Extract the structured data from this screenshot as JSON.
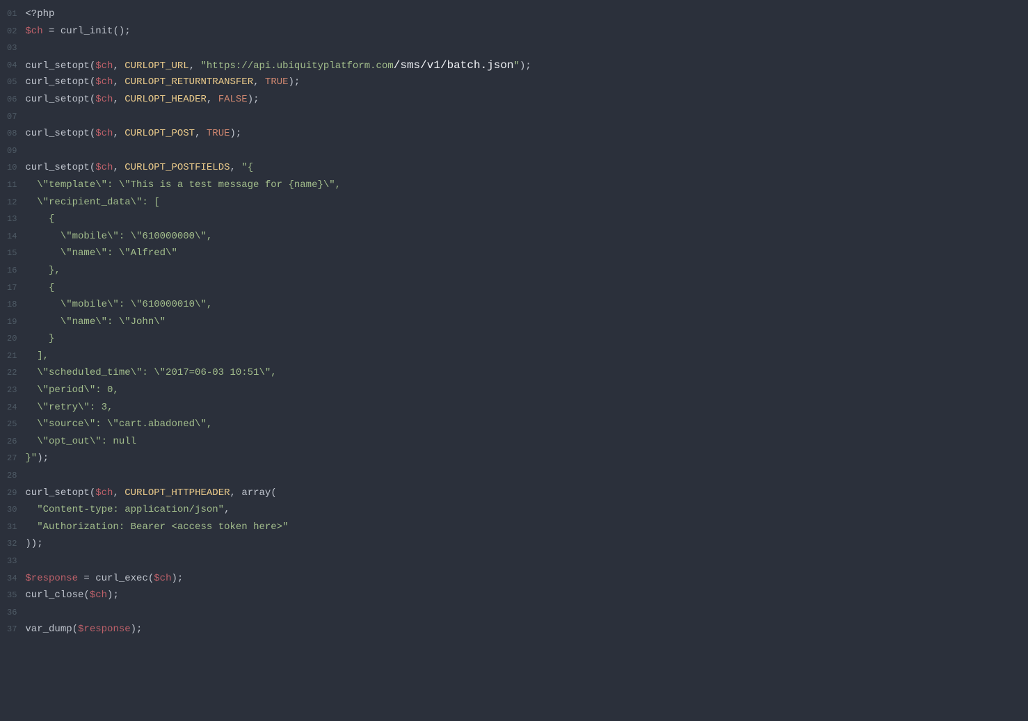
{
  "gutter": [
    "01",
    "02",
    "03",
    "04",
    "05",
    "06",
    "07",
    "08",
    "09",
    "10",
    "11",
    "12",
    "13",
    "14",
    "15",
    "16",
    "17",
    "18",
    "19",
    "20",
    "21",
    "22",
    "23",
    "24",
    "25",
    "26",
    "27",
    "28",
    "29",
    "30",
    "31",
    "32",
    "33",
    "34",
    "35",
    "36",
    "37"
  ],
  "lines": [
    [
      {
        "t": "<?php",
        "c": "tok-punct"
      }
    ],
    [
      {
        "t": "$ch",
        "c": "tok-var"
      },
      {
        "t": " = ",
        "c": "tok-punct"
      },
      {
        "t": "curl_init",
        "c": "tok-func"
      },
      {
        "t": "();",
        "c": "tok-punct"
      }
    ],
    [],
    [
      {
        "t": "curl_setopt",
        "c": "tok-func"
      },
      {
        "t": "(",
        "c": "tok-punct"
      },
      {
        "t": "$ch",
        "c": "tok-var"
      },
      {
        "t": ", ",
        "c": "tok-punct"
      },
      {
        "t": "CURLOPT_URL",
        "c": "tok-ident"
      },
      {
        "t": ", ",
        "c": "tok-punct"
      },
      {
        "t": "\"https://api.ubiquityplatform.com",
        "c": "tok-string"
      },
      {
        "t": "/sms/v1/batch.json",
        "c": "tok-stringEm"
      },
      {
        "t": "\"",
        "c": "tok-string"
      },
      {
        "t": ");",
        "c": "tok-punct"
      }
    ],
    [
      {
        "t": "curl_setopt",
        "c": "tok-func"
      },
      {
        "t": "(",
        "c": "tok-punct"
      },
      {
        "t": "$ch",
        "c": "tok-var"
      },
      {
        "t": ", ",
        "c": "tok-punct"
      },
      {
        "t": "CURLOPT_RETURNTRANSFER",
        "c": "tok-ident"
      },
      {
        "t": ", ",
        "c": "tok-punct"
      },
      {
        "t": "TRUE",
        "c": "tok-bool"
      },
      {
        "t": ");",
        "c": "tok-punct"
      }
    ],
    [
      {
        "t": "curl_setopt",
        "c": "tok-func"
      },
      {
        "t": "(",
        "c": "tok-punct"
      },
      {
        "t": "$ch",
        "c": "tok-var"
      },
      {
        "t": ", ",
        "c": "tok-punct"
      },
      {
        "t": "CURLOPT_HEADER",
        "c": "tok-ident"
      },
      {
        "t": ", ",
        "c": "tok-punct"
      },
      {
        "t": "FALSE",
        "c": "tok-bool"
      },
      {
        "t": ");",
        "c": "tok-punct"
      }
    ],
    [],
    [
      {
        "t": "curl_setopt",
        "c": "tok-func"
      },
      {
        "t": "(",
        "c": "tok-punct"
      },
      {
        "t": "$ch",
        "c": "tok-var"
      },
      {
        "t": ", ",
        "c": "tok-punct"
      },
      {
        "t": "CURLOPT_POST",
        "c": "tok-ident"
      },
      {
        "t": ", ",
        "c": "tok-punct"
      },
      {
        "t": "TRUE",
        "c": "tok-bool"
      },
      {
        "t": ");",
        "c": "tok-punct"
      }
    ],
    [],
    [
      {
        "t": "curl_setopt",
        "c": "tok-func"
      },
      {
        "t": "(",
        "c": "tok-punct"
      },
      {
        "t": "$ch",
        "c": "tok-var"
      },
      {
        "t": ", ",
        "c": "tok-punct"
      },
      {
        "t": "CURLOPT_POSTFIELDS",
        "c": "tok-ident"
      },
      {
        "t": ", ",
        "c": "tok-punct"
      },
      {
        "t": "\"{",
        "c": "tok-string"
      }
    ],
    [
      {
        "t": "  \\\"template\\\": \\\"This is a test message for {name}\\\",",
        "c": "tok-string"
      }
    ],
    [
      {
        "t": "  \\\"recipient_data\\\": [",
        "c": "tok-string"
      }
    ],
    [
      {
        "t": "    {",
        "c": "tok-string"
      }
    ],
    [
      {
        "t": "      \\\"mobile\\\": \\\"610000000\\\",",
        "c": "tok-string"
      }
    ],
    [
      {
        "t": "      \\\"name\\\": \\\"Alfred\\\"",
        "c": "tok-string"
      }
    ],
    [
      {
        "t": "    },",
        "c": "tok-string"
      }
    ],
    [
      {
        "t": "    {",
        "c": "tok-string"
      }
    ],
    [
      {
        "t": "      \\\"mobile\\\": \\\"610000010\\\",",
        "c": "tok-string"
      }
    ],
    [
      {
        "t": "      \\\"name\\\": \\\"John\\\"",
        "c": "tok-string"
      }
    ],
    [
      {
        "t": "    }",
        "c": "tok-string"
      }
    ],
    [
      {
        "t": "  ],",
        "c": "tok-string"
      }
    ],
    [
      {
        "t": "  \\\"scheduled_time\\\": \\\"2017=06-03 10:51\\\",",
        "c": "tok-string"
      }
    ],
    [
      {
        "t": "  \\\"period\\\": 0,",
        "c": "tok-string"
      }
    ],
    [
      {
        "t": "  \\\"retry\\\": 3,",
        "c": "tok-string"
      }
    ],
    [
      {
        "t": "  \\\"source\\\": \\\"cart.abadoned\\\",",
        "c": "tok-string"
      }
    ],
    [
      {
        "t": "  \\\"opt_out\\\": null",
        "c": "tok-string"
      }
    ],
    [
      {
        "t": "}\"",
        "c": "tok-string"
      },
      {
        "t": ");",
        "c": "tok-punct"
      }
    ],
    [],
    [
      {
        "t": "curl_setopt",
        "c": "tok-func"
      },
      {
        "t": "(",
        "c": "tok-punct"
      },
      {
        "t": "$ch",
        "c": "tok-var"
      },
      {
        "t": ", ",
        "c": "tok-punct"
      },
      {
        "t": "CURLOPT_HTTPHEADER",
        "c": "tok-ident"
      },
      {
        "t": ", ",
        "c": "tok-punct"
      },
      {
        "t": "array",
        "c": "tok-func"
      },
      {
        "t": "(",
        "c": "tok-punct"
      }
    ],
    [
      {
        "t": "  ",
        "c": "tok-punct"
      },
      {
        "t": "\"Content-type: application/json\"",
        "c": "tok-string"
      },
      {
        "t": ",",
        "c": "tok-punct"
      }
    ],
    [
      {
        "t": "  ",
        "c": "tok-punct"
      },
      {
        "t": "\"Authorization: Bearer <access token here>\"",
        "c": "tok-string"
      }
    ],
    [
      {
        "t": "));",
        "c": "tok-punct"
      }
    ],
    [],
    [
      {
        "t": "$response",
        "c": "tok-var"
      },
      {
        "t": " = ",
        "c": "tok-punct"
      },
      {
        "t": "curl_exec",
        "c": "tok-func"
      },
      {
        "t": "(",
        "c": "tok-punct"
      },
      {
        "t": "$ch",
        "c": "tok-var"
      },
      {
        "t": ");",
        "c": "tok-punct"
      }
    ],
    [
      {
        "t": "curl_close",
        "c": "tok-func"
      },
      {
        "t": "(",
        "c": "tok-punct"
      },
      {
        "t": "$ch",
        "c": "tok-var"
      },
      {
        "t": ");",
        "c": "tok-punct"
      }
    ],
    [],
    [
      {
        "t": "var_dump",
        "c": "tok-func"
      },
      {
        "t": "(",
        "c": "tok-punct"
      },
      {
        "t": "$response",
        "c": "tok-var"
      },
      {
        "t": ");",
        "c": "tok-punct"
      }
    ]
  ]
}
